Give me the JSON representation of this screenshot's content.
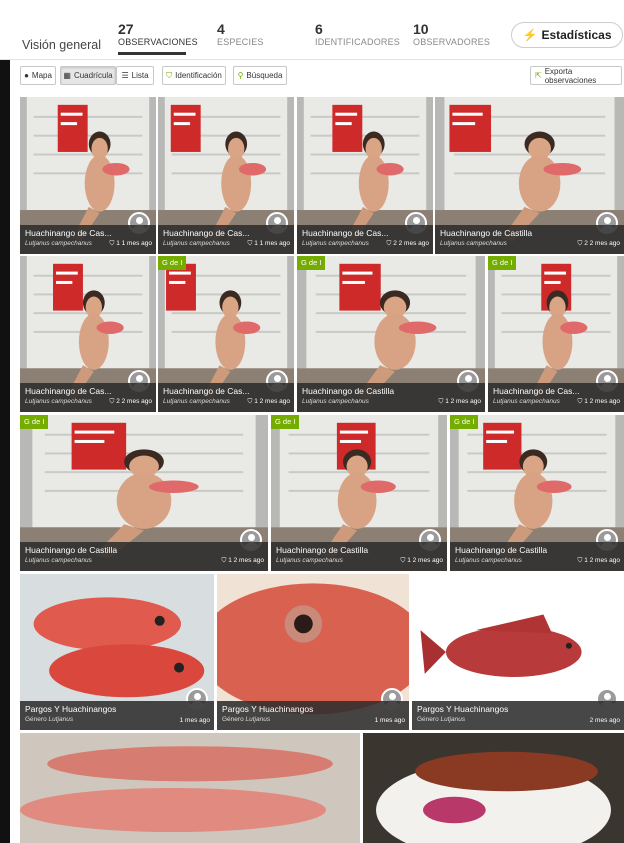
{
  "header": {
    "overview_label": "Visión general",
    "stats": [
      {
        "num": "27",
        "label": "OBSERVACIONES",
        "active": true
      },
      {
        "num": "4",
        "label": "ESPECIES",
        "active": false
      },
      {
        "num": "6",
        "label": "IDENTIFICADORES",
        "active": false
      },
      {
        "num": "10",
        "label": "OBSERVADORES",
        "active": false
      }
    ],
    "stats_button": "Estadísticas"
  },
  "toolbar": {
    "map": "Mapa",
    "grid": "Cuadrícula",
    "list": "Lista",
    "identify": "Identificación",
    "search": "Búsqueda",
    "export": "Exporta observaciones"
  },
  "observations": [
    {
      "name": "Huachinango de Cas...",
      "sci": "Lutjanus campechanus",
      "time": "1 1 mes ago",
      "badge": "",
      "scene": "fridge"
    },
    {
      "name": "Huachinango de Cas...",
      "sci": "Lutjanus campechanus",
      "time": "1 1 mes ago",
      "badge": "",
      "scene": "fridge"
    },
    {
      "name": "Huachinango de Cas...",
      "sci": "Lutjanus campechanus",
      "time": "2 2 mes ago",
      "badge": "",
      "scene": "fridge"
    },
    {
      "name": "Huachinango de Castilla",
      "sci": "Lutjanus campechanus",
      "time": "2 2 mes ago",
      "badge": "",
      "scene": "fridge"
    },
    {
      "name": "Huachinango de Cas...",
      "sci": "Lutjanus campechanus",
      "time": "2 2 mes ago",
      "badge": "",
      "scene": "fridge"
    },
    {
      "name": "Huachinango de Cas...",
      "sci": "Lutjanus campechanus",
      "time": "1 2 mes ago",
      "badge": "G de I",
      "scene": "fridge"
    },
    {
      "name": "Huachinango de Castilla",
      "sci": "Lutjanus campechanus",
      "time": "1 2 mes ago",
      "badge": "G de I",
      "scene": "fridge"
    },
    {
      "name": "Huachinango de Cas...",
      "sci": "Lutjanus campechanus",
      "time": "1 2 mes ago",
      "badge": "G de I",
      "scene": "fridge"
    },
    {
      "name": "Huachinango de Castilla",
      "sci": "Lutjanus campechanus",
      "time": "1 2 mes ago",
      "badge": "G de I",
      "scene": "fridge"
    },
    {
      "name": "Huachinango de Castilla",
      "sci": "Lutjanus campechanus",
      "time": "1 2 mes ago",
      "badge": "G de I",
      "scene": "fridge"
    },
    {
      "name": "Huachinango de Castilla",
      "sci": "Lutjanus campechanus",
      "time": "1 2 mes ago",
      "badge": "G de I",
      "scene": "fridge"
    },
    {
      "name": "Pargos Y Huachinangos",
      "sci_prefix": "Género",
      "sci": "Lutjanus",
      "time": "1 mes ago",
      "badge": "",
      "scene": "fish-ice"
    },
    {
      "name": "Pargos Y Huachinangos",
      "sci_prefix": "Género",
      "sci": "Lutjanus",
      "time": "1 mes ago",
      "badge": "",
      "scene": "fish-head"
    },
    {
      "name": "Pargos Y Huachinangos",
      "sci_prefix": "Género",
      "sci": "Lutjanus",
      "time": "2 mes ago",
      "badge": "",
      "scene": "fish-white"
    },
    {
      "name": "",
      "sci": "",
      "time": "",
      "badge": "",
      "scene": "fish-market"
    },
    {
      "name": "",
      "sci": "",
      "time": "",
      "badge": "",
      "scene": "fish-plate"
    }
  ],
  "colors": {
    "accent": "#74ac00",
    "caption_bg": "#2d2d2d"
  }
}
